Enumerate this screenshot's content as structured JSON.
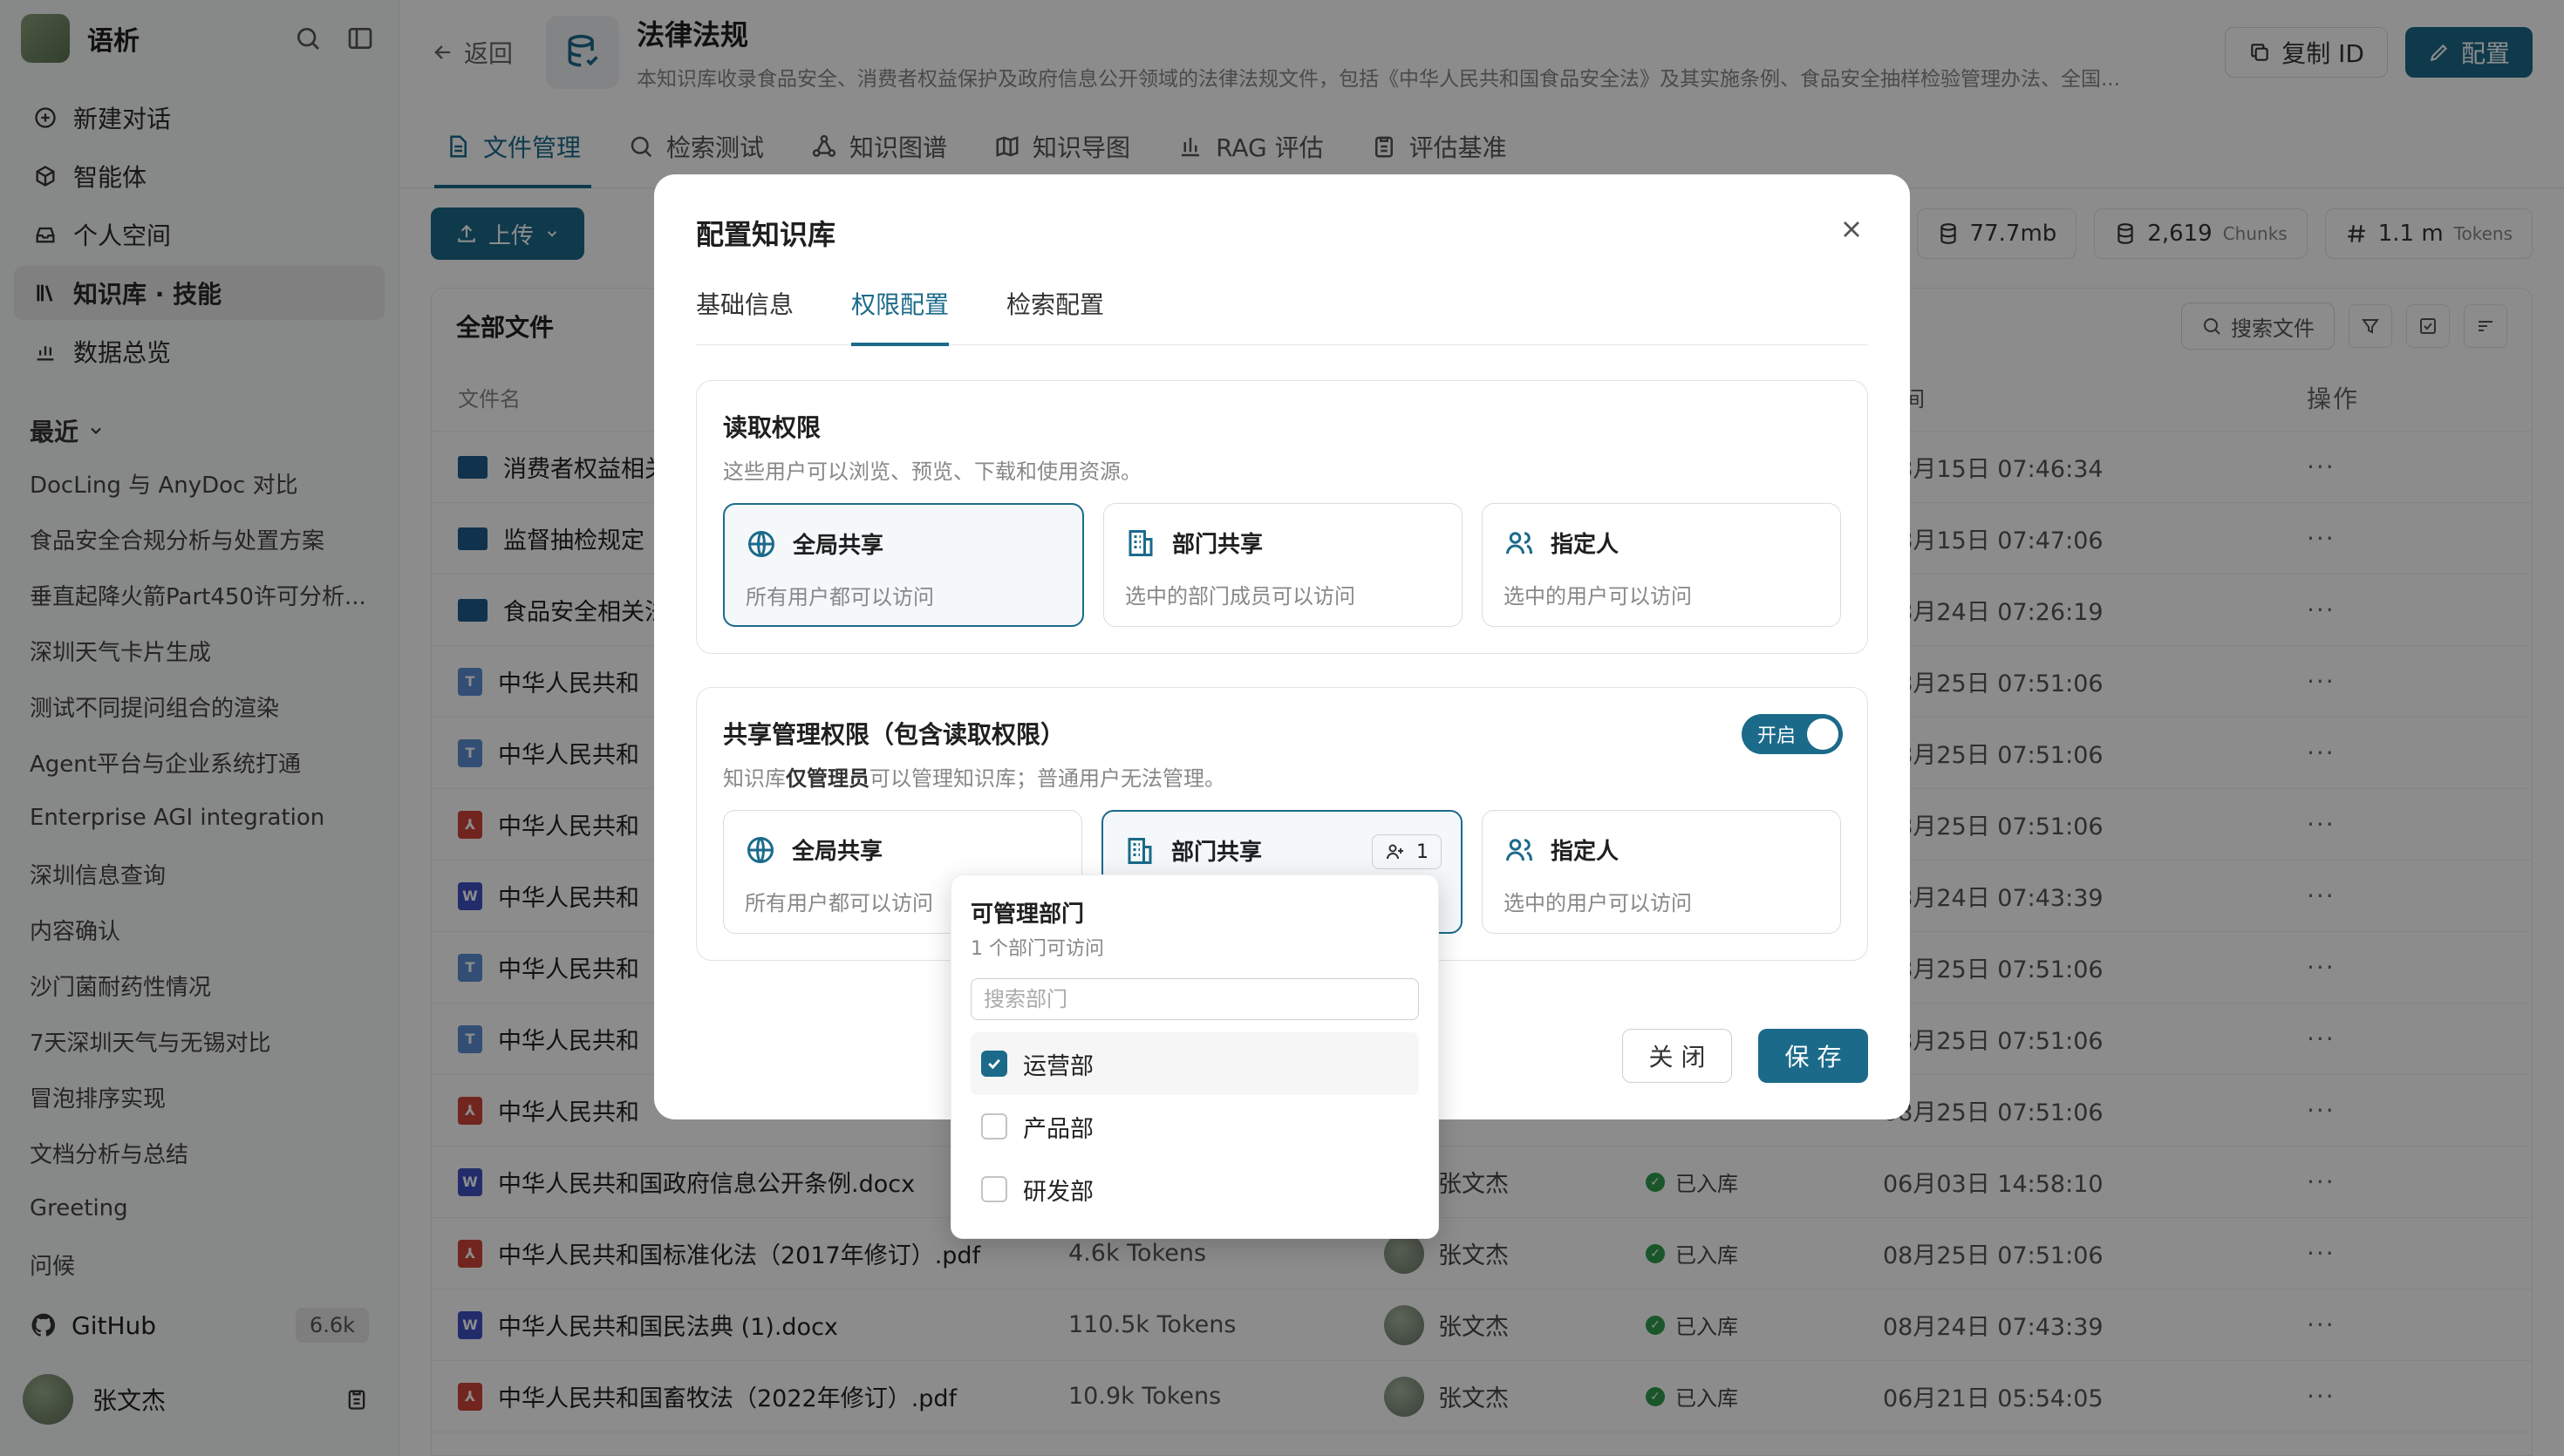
{
  "sidebar": {
    "app_name": "语析",
    "nav": [
      {
        "label": "新建对话",
        "icon": "plus-circle-icon"
      },
      {
        "label": "智能体",
        "icon": "cube-icon"
      },
      {
        "label": "个人空间",
        "icon": "inbox-icon"
      },
      {
        "label": "知识库 · 技能",
        "icon": "library-icon"
      },
      {
        "label": "数据总览",
        "icon": "bar-chart-icon"
      }
    ],
    "recent_label": "最近",
    "recent": [
      "DocLing 与 AnyDoc 对比",
      "食品安全合规分析与处置方案",
      "垂直起降火箭Part450许可分析...",
      "深圳天气卡片生成",
      "测试不同提问组合的渲染",
      "Agent平台与企业系统打通",
      "Enterprise AGI integration",
      "深圳信息查询",
      "内容确认",
      "沙门菌耐药性情况",
      "7天深圳天气与无锡对比",
      "冒泡排序实现",
      "文档分析与总结",
      "Greeting",
      "问候"
    ],
    "github_label": "GitHub",
    "github_stars": "6.6k",
    "user_name": "张文杰"
  },
  "header": {
    "back_label": "返回",
    "title": "法律法规",
    "description": "本知识库收录食品安全、消费者权益保护及政府信息公开领域的法律法规文件，包括《中华人民共和国食品安全法》及其实施条例、食品安全抽样检验管理办法、全国...",
    "copy_id_label": "复制 ID",
    "config_label": "配置"
  },
  "tabs": [
    {
      "label": "文件管理",
      "icon": "file-icon"
    },
    {
      "label": "检索测试",
      "icon": "search-icon"
    },
    {
      "label": "知识图谱",
      "icon": "graph-icon"
    },
    {
      "label": "知识导图",
      "icon": "map-icon"
    },
    {
      "label": "RAG 评估",
      "icon": "chart-icon"
    },
    {
      "label": "评估基准",
      "icon": "clipboard-icon"
    }
  ],
  "toolbar": {
    "upload_label": "上传",
    "size": "77.7mb",
    "chunks": "2,619",
    "chunks_unit": "Chunks",
    "tokens": "1.1 m",
    "tokens_unit": "Tokens"
  },
  "files": {
    "title": "全部文件",
    "search_label": "搜索文件",
    "col_name": "文件名",
    "col_time": "时间",
    "col_op": "操作",
    "rows": [
      {
        "name": "消费者权益相关",
        "type": "folder",
        "tokens": "",
        "user": "",
        "status": "",
        "time": "08月15日 07:46:34"
      },
      {
        "name": "监督抽检规定",
        "type": "folder",
        "tokens": "",
        "user": "",
        "status": "",
        "time": "08月15日 07:47:06"
      },
      {
        "name": "食品安全相关法",
        "type": "folder",
        "tokens": "",
        "user": "",
        "status": "",
        "time": "08月24日 07:26:19"
      },
      {
        "name": "中华人民共和",
        "type": "txt",
        "tokens": "",
        "user": "",
        "status": "",
        "time": "08月25日 07:51:06"
      },
      {
        "name": "中华人民共和",
        "type": "txt",
        "tokens": "",
        "user": "",
        "status": "",
        "time": "08月25日 07:51:06"
      },
      {
        "name": "中华人民共和",
        "type": "pdf",
        "tokens": "",
        "user": "",
        "status": "",
        "time": "08月25日 07:51:06"
      },
      {
        "name": "中华人民共和",
        "type": "doc",
        "tokens": "",
        "user": "",
        "status": "",
        "time": "08月24日 07:43:39"
      },
      {
        "name": "中华人民共和",
        "type": "txt",
        "tokens": "",
        "user": "",
        "status": "",
        "time": "08月25日 07:51:06"
      },
      {
        "name": "中华人民共和",
        "type": "txt",
        "tokens": "",
        "user": "",
        "status": "",
        "time": "08月25日 07:51:06"
      },
      {
        "name": "中华人民共和",
        "type": "pdf",
        "tokens": "",
        "user": "",
        "status": "",
        "time": "08月25日 07:51:06"
      },
      {
        "name": "中华人民共和国政府信息公开条例.docx",
        "type": "doc",
        "tokens": "",
        "user": "张文杰",
        "status": "已入库",
        "time": "06月03日 14:58:10"
      },
      {
        "name": "中华人民共和国标准化法（2017年修订）.pdf",
        "type": "pdf",
        "tokens": "4.6k Tokens",
        "user": "张文杰",
        "status": "已入库",
        "time": "08月25日 07:51:06"
      },
      {
        "name": "中华人民共和国民法典 (1).docx",
        "type": "doc",
        "tokens": "110.5k Tokens",
        "user": "张文杰",
        "status": "已入库",
        "time": "08月24日 07:43:39"
      },
      {
        "name": "中华人民共和国畜牧法（2022年修订）.pdf",
        "type": "pdf",
        "tokens": "10.9k Tokens",
        "user": "张文杰",
        "status": "已入库",
        "time": "06月21日 05:54:05"
      }
    ]
  },
  "modal": {
    "title": "配置知识库",
    "tabs": [
      "基础信息",
      "权限配置",
      "检索配置"
    ],
    "read": {
      "title": "读取权限",
      "desc": "这些用户可以浏览、预览、下载和使用资源。",
      "options": [
        {
          "title": "全局共享",
          "desc": "所有用户都可以访问",
          "icon": "globe-icon"
        },
        {
          "title": "部门共享",
          "desc": "选中的部门成员可以访问",
          "icon": "building-icon"
        },
        {
          "title": "指定人",
          "desc": "选中的用户可以访问",
          "icon": "users-icon"
        }
      ]
    },
    "manage": {
      "title": "共享管理权限（包含读取权限）",
      "desc_pre": "知识库",
      "desc_bold": "仅管理员",
      "desc_post": "可以管理知识库；普通用户无法管理。",
      "toggle_label": "开启",
      "options": [
        {
          "title": "全局共享",
          "desc": "所有用户都可以访问",
          "icon": "globe-icon"
        },
        {
          "title": "部门共享",
          "desc": "",
          "icon": "building-icon",
          "count": "1"
        },
        {
          "title": "指定人",
          "desc": "选中的用户可以访问",
          "icon": "users-icon"
        }
      ]
    },
    "close_label": "关 闭",
    "save_label": "保 存"
  },
  "dept_dropdown": {
    "title": "可管理部门",
    "subtitle": "1 个部门可访问",
    "search_placeholder": "搜索部门",
    "items": [
      {
        "label": "运营部",
        "checked": true
      },
      {
        "label": "产品部",
        "checked": false
      },
      {
        "label": "研发部",
        "checked": false
      }
    ]
  }
}
